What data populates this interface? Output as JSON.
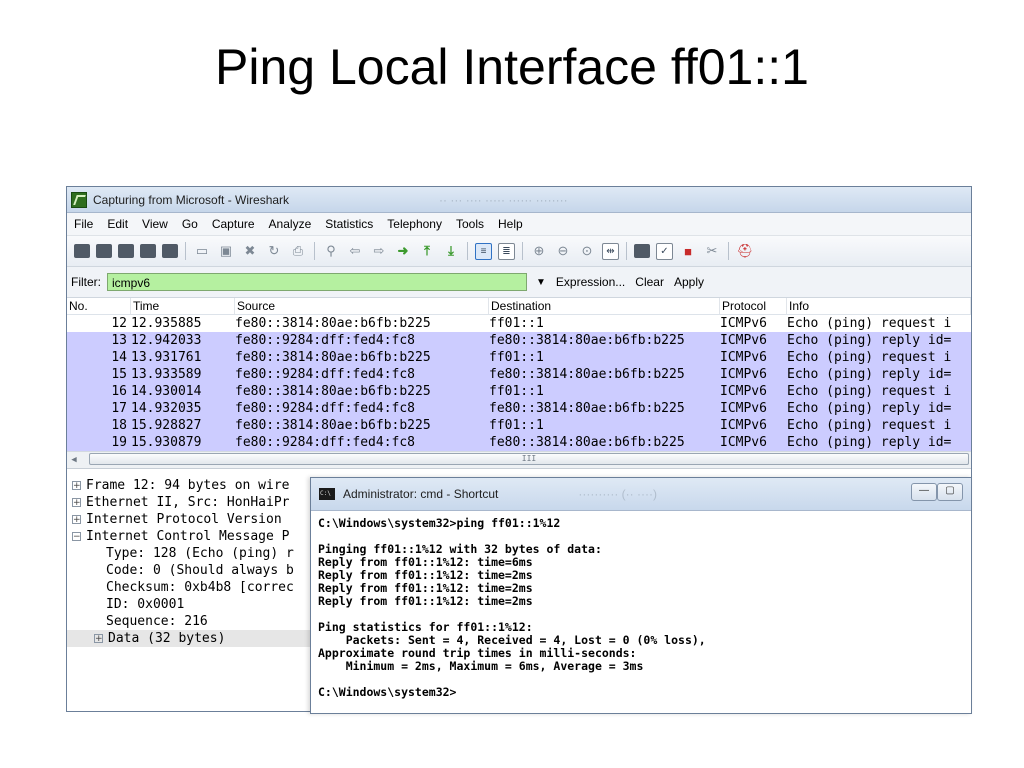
{
  "slide": {
    "title": "Ping Local Interface ff01::1"
  },
  "wireshark": {
    "title": "Capturing from Microsoft - Wireshark",
    "ghost_title": "·· ··· ···· ·····  ······  ········",
    "menu": [
      "File",
      "Edit",
      "View",
      "Go",
      "Capture",
      "Analyze",
      "Statistics",
      "Telephony",
      "Tools",
      "Help"
    ],
    "toolbar_icons": [
      "interface-list-icon",
      "capture-options-icon",
      "start-capture-icon",
      "stop-capture-icon",
      "restart-capture-icon",
      "open-file-icon",
      "save-file-icon",
      "close-file-icon",
      "reload-icon",
      "print-icon",
      "find-icon",
      "back-icon",
      "forward-icon",
      "go-to-packet-icon",
      "first-packet-icon",
      "last-packet-icon",
      "colorize-icon",
      "autoscroll-icon",
      "zoom-in-icon",
      "zoom-out-icon",
      "normal-size-icon",
      "resize-columns-icon",
      "capture-filters-icon",
      "display-filters-icon",
      "coloring-rules-icon",
      "preferences-icon",
      "help-icon"
    ],
    "filter": {
      "label": "Filter:",
      "value": "icmpv6",
      "expression": "Expression...",
      "clear": "Clear",
      "apply": "Apply"
    },
    "columns": {
      "no": "No.",
      "time": "Time",
      "source": "Source",
      "destination": "Destination",
      "protocol": "Protocol",
      "info": "Info"
    },
    "packets": [
      {
        "no": "12",
        "time": "12.935885",
        "source": "fe80::3814:80ae:b6fb:b225",
        "destination": "ff01::1",
        "protocol": "ICMPv6",
        "info": "Echo (ping) request i"
      },
      {
        "no": "13",
        "time": "12.942033",
        "source": "fe80::9284:dff:fed4:fc8",
        "destination": "fe80::3814:80ae:b6fb:b225",
        "protocol": "ICMPv6",
        "info": "Echo (ping) reply id="
      },
      {
        "no": "14",
        "time": "13.931761",
        "source": "fe80::3814:80ae:b6fb:b225",
        "destination": "ff01::1",
        "protocol": "ICMPv6",
        "info": "Echo (ping) request i"
      },
      {
        "no": "15",
        "time": "13.933589",
        "source": "fe80::9284:dff:fed4:fc8",
        "destination": "fe80::3814:80ae:b6fb:b225",
        "protocol": "ICMPv6",
        "info": "Echo (ping) reply id="
      },
      {
        "no": "16",
        "time": "14.930014",
        "source": "fe80::3814:80ae:b6fb:b225",
        "destination": "ff01::1",
        "protocol": "ICMPv6",
        "info": "Echo (ping) request i"
      },
      {
        "no": "17",
        "time": "14.932035",
        "source": "fe80::9284:dff:fed4:fc8",
        "destination": "fe80::3814:80ae:b6fb:b225",
        "protocol": "ICMPv6",
        "info": "Echo (ping) reply id="
      },
      {
        "no": "18",
        "time": "15.928827",
        "source": "fe80::3814:80ae:b6fb:b225",
        "destination": "ff01::1",
        "protocol": "ICMPv6",
        "info": "Echo (ping) request i"
      },
      {
        "no": "19",
        "time": "15.930879",
        "source": "fe80::9284:dff:fed4:fc8",
        "destination": "fe80::3814:80ae:b6fb:b225",
        "protocol": "ICMPv6",
        "info": "Echo (ping) reply id="
      }
    ],
    "scroll_grip": "III",
    "details": [
      {
        "text": "Frame 12: 94 bytes on wire",
        "expander": "+",
        "level": 0
      },
      {
        "text": "Ethernet II, Src: HonHaiPr",
        "expander": "+",
        "level": 0
      },
      {
        "text": "Internet Protocol Version",
        "expander": "+",
        "level": 0
      },
      {
        "text": "Internet Control Message P",
        "expander": "−",
        "level": 0
      },
      {
        "text": "Type: 128 (Echo (ping) r",
        "expander": "",
        "level": 1
      },
      {
        "text": "Code: 0 (Should always b",
        "expander": "",
        "level": 1
      },
      {
        "text": "Checksum: 0xb4b8 [correc",
        "expander": "",
        "level": 1
      },
      {
        "text": "ID: 0x0001",
        "expander": "",
        "level": 1
      },
      {
        "text": "Sequence: 216",
        "expander": "",
        "level": 1
      },
      {
        "text": "Data (32 bytes)",
        "expander": "+",
        "level": 2
      }
    ]
  },
  "cmd": {
    "title": "Administrator: cmd - Shortcut",
    "ghost_title": "·········· (·· ····)",
    "icon_text": "C:\\",
    "minimize": "—",
    "maximize": "▢",
    "lines": [
      "C:\\Windows\\system32>ping ff01::1%12",
      "",
      "Pinging ff01::1%12 with 32 bytes of data:",
      "Reply from ff01::1%12: time=6ms",
      "Reply from ff01::1%12: time=2ms",
      "Reply from ff01::1%12: time=2ms",
      "Reply from ff01::1%12: time=2ms",
      "",
      "Ping statistics for ff01::1%12:",
      "    Packets: Sent = 4, Received = 4, Lost = 0 (0% loss),",
      "Approximate round trip times in milli-seconds:",
      "    Minimum = 2ms, Maximum = 6ms, Average = 3ms",
      "",
      "C:\\Windows\\system32>"
    ]
  },
  "colors": {
    "filter_bg": "#b5f0a0",
    "row_highlight": "#ccccff",
    "title_bar": "#dfe9f5"
  }
}
